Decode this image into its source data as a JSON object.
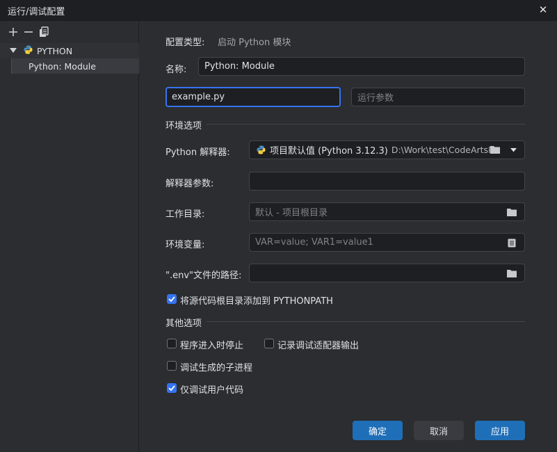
{
  "window": {
    "title": "运行/调试配置"
  },
  "sidebar": {
    "group_label": "PYTHON",
    "items": [
      {
        "label": "Python: Module"
      }
    ]
  },
  "form": {
    "config_type_label": "配置类型:",
    "config_type_value": "启动 Python 模块",
    "name_label": "名称:",
    "name_value": "Python: Module",
    "module_value": "example.py",
    "args_placeholder": "运行参数",
    "env_section": "环境选项",
    "interpreter_label": "Python 解释器:",
    "interpreter_value": "项目默认值 (Python 3.12.3)",
    "interpreter_path": "D:\\Work\\test\\CodeArtsPro",
    "interpreter_args_label": "解释器参数:",
    "workdir_label": "工作目录:",
    "workdir_placeholder": "默认 - 项目根目录",
    "envvars_label": "环境变量:",
    "envvars_placeholder": "VAR=value; VAR1=value1",
    "envfile_label": "\".env\"文件的路径:",
    "add_pythonpath_label": "将源代码根目录添加到 PYTHONPATH",
    "add_pythonpath_checked": true,
    "other_section": "其他选项",
    "stop_on_entry_label": "程序进入时停止",
    "stop_on_entry_checked": false,
    "log_adapter_label": "记录调试适配器输出",
    "log_adapter_checked": false,
    "debug_subprocess_label": "调试生成的子进程",
    "debug_subprocess_checked": false,
    "just_my_code_label": "仅调试用户代码",
    "just_my_code_checked": true
  },
  "buttons": {
    "ok": "确定",
    "cancel": "取消",
    "apply": "应用"
  },
  "colors": {
    "accent": "#3574f0",
    "primary_button": "#1f6fb8",
    "background": "#2b2d30",
    "field_bg": "#1e1f22"
  },
  "icons": [
    "close-icon",
    "add-icon",
    "remove-icon",
    "copy-icon",
    "caret-down-icon",
    "python-icon",
    "folder-icon",
    "list-icon",
    "check-icon"
  ]
}
